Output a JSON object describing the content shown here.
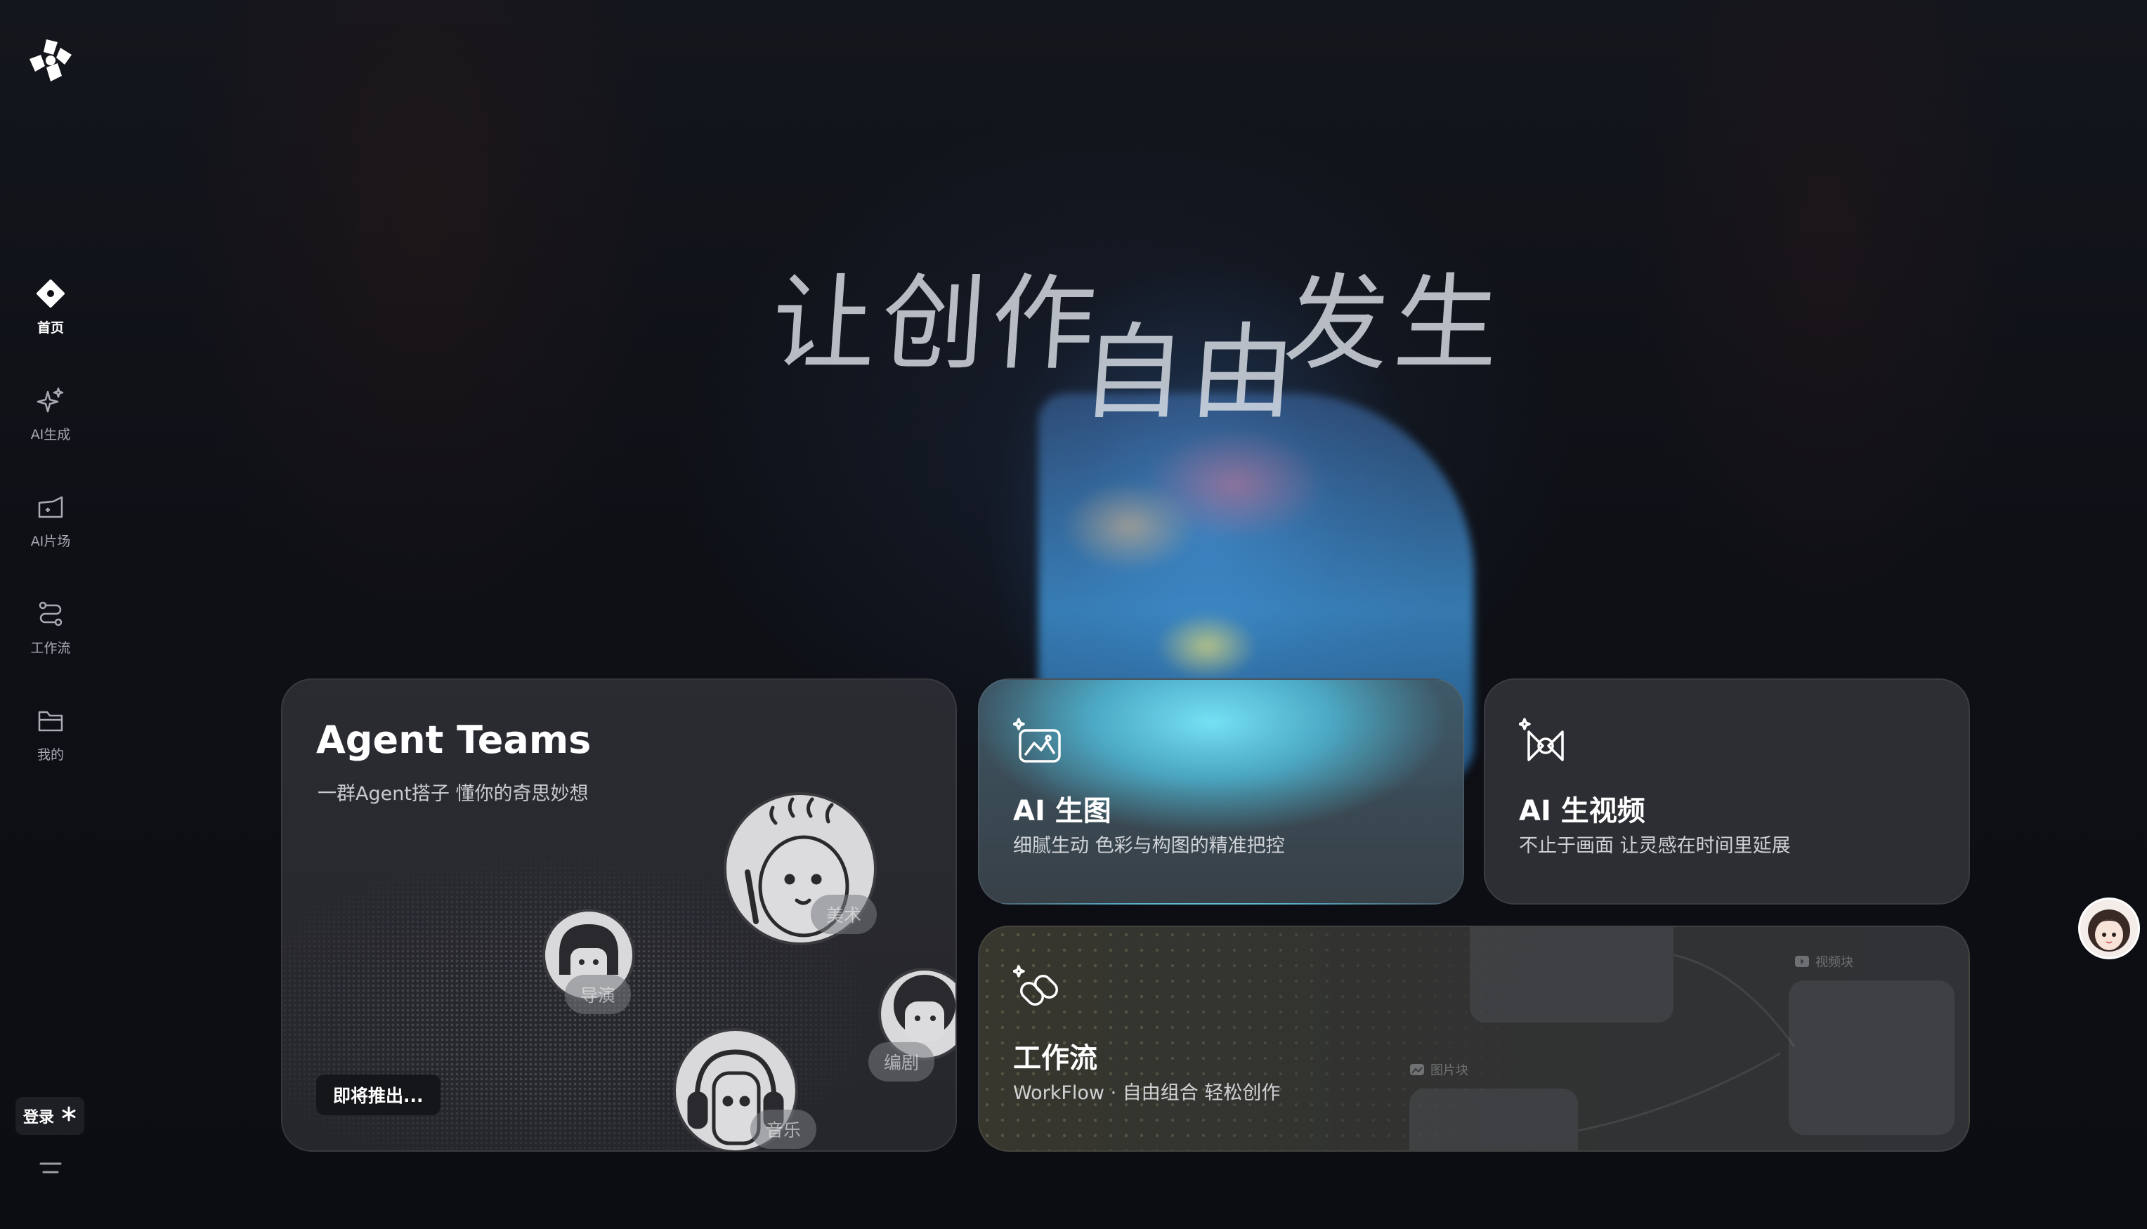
{
  "sidebar": {
    "logo": "app-logo",
    "items": [
      {
        "label": "首页",
        "icon": "home-icon",
        "active": true
      },
      {
        "label": "AI生成",
        "icon": "sparkle-icon",
        "active": false
      },
      {
        "label": "AI片场",
        "icon": "studio-icon",
        "active": false
      },
      {
        "label": "工作流",
        "icon": "workflow-icon",
        "active": false
      },
      {
        "label": "我的",
        "icon": "folder-icon",
        "active": false
      }
    ],
    "login_label": "登录",
    "login_icon": "asterisk-icon",
    "menu_icon": "menu-icon"
  },
  "hero": {
    "headline_part1": "让创作",
    "headline_part2": "自由",
    "headline_part3": "发生"
  },
  "cards": {
    "agent": {
      "title": "Agent Teams",
      "subtitle": "一群Agent搭子 懂你的奇思妙想",
      "button": "即将推出...",
      "roles": [
        "美术",
        "导演",
        "编剧",
        "音乐"
      ]
    },
    "image": {
      "title": "AI 生图",
      "subtitle": "细腻生动 色彩与构图的精准把控",
      "icon": "image-sparkle-icon"
    },
    "video": {
      "title": "AI 生视频",
      "subtitle": "不止于画面 让灵感在时间里延展",
      "icon": "video-sparkle-icon"
    },
    "workflow": {
      "title": "工作流",
      "subtitle": "WorkFlow · 自由组合 轻松创作",
      "icon": "link-sparkle-icon",
      "node_labels": [
        "视频块",
        "图片块"
      ]
    }
  },
  "colors": {
    "background": "#0c0e14",
    "card": "#34363c",
    "accent_glow": "#6fe0f5"
  }
}
